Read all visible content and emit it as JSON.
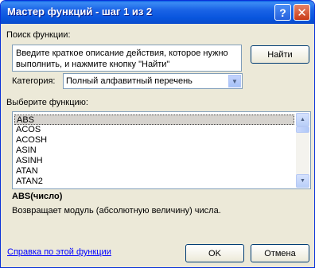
{
  "window": {
    "title": "Мастер функций - шаг 1 из 2"
  },
  "search": {
    "label": "Поиск функции:",
    "description": "Введите краткое описание действия, которое нужно выполнить, и нажмите кнопку \"Найти\"",
    "find_button": "Найти"
  },
  "category": {
    "label": "Категория:",
    "value": "Полный алфавитный перечень"
  },
  "functions": {
    "label": "Выберите функцию:",
    "items": [
      "ABS",
      "ACOS",
      "ACOSH",
      "ASIN",
      "ASINH",
      "ATAN",
      "ATAN2"
    ],
    "selected": "ABS",
    "signature": "ABS(число)",
    "summary": "Возвращает модуль (абсолютную величину) числа."
  },
  "footer": {
    "help_link": "Справка по этой функции",
    "ok_button": "OK",
    "cancel_button": "Отмена"
  }
}
